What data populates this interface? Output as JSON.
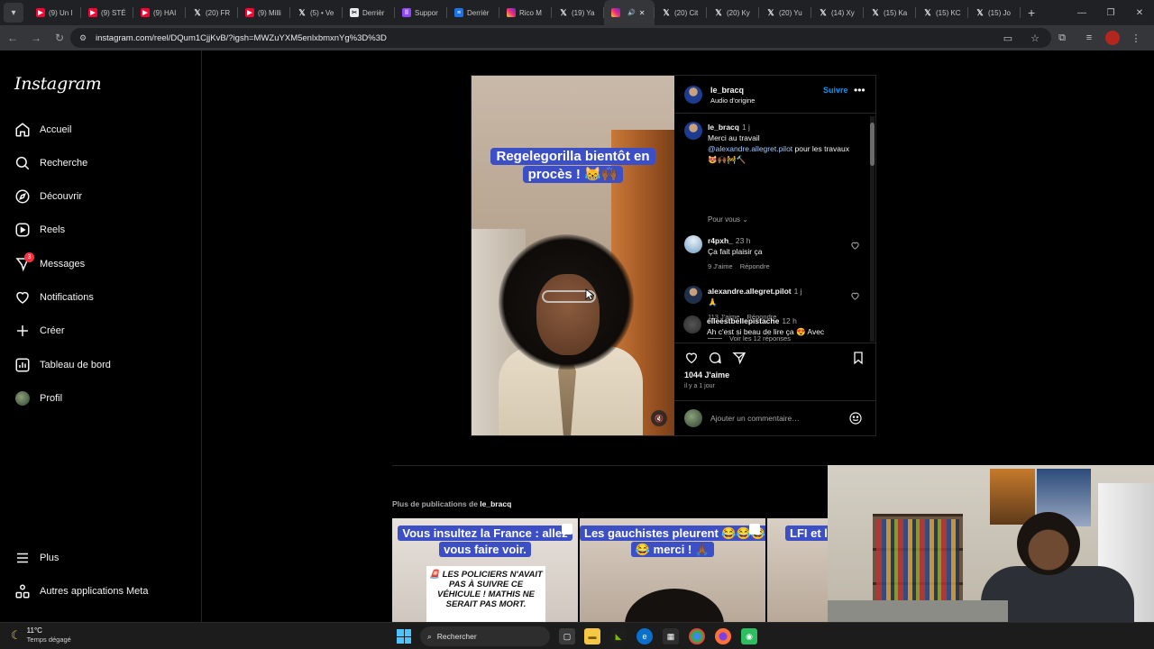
{
  "browser": {
    "tabs": [
      {
        "icon": "youtube-icon",
        "label": "(9) Un l"
      },
      {
        "icon": "youtube-icon",
        "label": "(9) STÉ"
      },
      {
        "icon": "youtube-icon",
        "label": "(9) HAI"
      },
      {
        "icon": "x-icon",
        "label": "(20) FR"
      },
      {
        "icon": "youtube-icon",
        "label": "(9) Milli"
      },
      {
        "icon": "x-icon",
        "label": "(5) • Ve"
      },
      {
        "icon": "clip-icon",
        "label": "Derrièr"
      },
      {
        "icon": "twitch-icon",
        "label": "Suppor"
      },
      {
        "icon": "doc-icon",
        "label": "Derrièr"
      },
      {
        "icon": "instagram-icon",
        "label": "Rico M"
      },
      {
        "icon": "x-icon",
        "label": "(19) Ya"
      },
      {
        "icon": "instagram-icon",
        "label": "",
        "active": true
      },
      {
        "icon": "x-icon",
        "label": "(20) Cit"
      },
      {
        "icon": "x-icon",
        "label": "(20) Ky"
      },
      {
        "icon": "x-icon",
        "label": "(20) Yu"
      },
      {
        "icon": "x-icon",
        "label": "(14) Xy"
      },
      {
        "icon": "x-icon",
        "label": "(15) Ka"
      },
      {
        "icon": "x-icon",
        "label": "(15) KC"
      },
      {
        "icon": "x-icon",
        "label": "(15) Jo"
      }
    ],
    "url": "instagram.com/reel/DQum1CjjKvB/?igsh=MWZuYXM5enlxbmxnYg%3D%3D"
  },
  "sidebar": {
    "logo": "Instagram",
    "items": [
      {
        "label": "Accueil",
        "icon": "home-icon"
      },
      {
        "label": "Recherche",
        "icon": "search-icon"
      },
      {
        "label": "Découvrir",
        "icon": "compass-icon"
      },
      {
        "label": "Reels",
        "icon": "reels-icon"
      },
      {
        "label": "Messages",
        "icon": "messenger-icon",
        "badge": "3"
      },
      {
        "label": "Notifications",
        "icon": "heart-icon"
      },
      {
        "label": "Créer",
        "icon": "plus-icon"
      },
      {
        "label": "Tableau de bord",
        "icon": "chart-icon"
      },
      {
        "label": "Profil",
        "icon": "profile-avatar"
      }
    ],
    "bottom": [
      {
        "label": "Plus",
        "icon": "menu-icon"
      },
      {
        "label": "Autres applications Meta",
        "icon": "meta-apps-icon"
      }
    ]
  },
  "post": {
    "caption_overlay": "Regelegorilla bientôt en procès ! 😹🙌🏾",
    "author": "le_bracq",
    "audio": "Audio d'origine",
    "follow": "Suivre",
    "caption": {
      "user": "le_bracq",
      "time": "1 j",
      "line1": "Merci au travail",
      "mention": "@alexandre.allegret.pilot",
      "rest": " pour les travaux 😻🙌🏾🚧🔨"
    },
    "pour_vous": "Pour vous",
    "comments": [
      {
        "user": "r4pxh_",
        "time": "23 h",
        "text": "Ça fait plaisir ça",
        "likes": "9 J'aime",
        "reply": "Répondre"
      },
      {
        "user": "alexandre.allegret.pilot",
        "time": "1 j",
        "text": "🙏",
        "likes": "113 J'aime",
        "reply": "Répondre"
      },
      {
        "user": "elleestbellepistache",
        "time": "12 h",
        "text": "Ah c'est si beau de lire ça 😍 Avec"
      }
    ],
    "view_replies": "Voir les 12 réponses",
    "likes_count": "1044 J'aime",
    "posted_ago": "il y a 1 jour",
    "add_comment_placeholder": "Ajouter un commentaire…"
  },
  "more": {
    "prefix": "Plus de publications de ",
    "user": "le_bracq",
    "thumbs": [
      {
        "caption": "Vous insultez la France : allez vous faire voir.",
        "card": "🚨 LES POLICIERS N'AVAIT PAS À SUIVRE CE VÉHICULE ! MATHIS NE SERAIT PAS MORT."
      },
      {
        "caption": "Les gauchistes pleurent 😂😂😂😂 merci ! 🙏🏾"
      },
      {
        "caption": "LFI et l'h"
      }
    ]
  },
  "taskbar": {
    "temp": "11°C",
    "condition": "Temps dégagé",
    "search": "Rechercher"
  },
  "colors": {
    "accent_blue": "#0095f6",
    "caption_bg": "#3d4fc4",
    "badge_red": "#ff3040"
  }
}
